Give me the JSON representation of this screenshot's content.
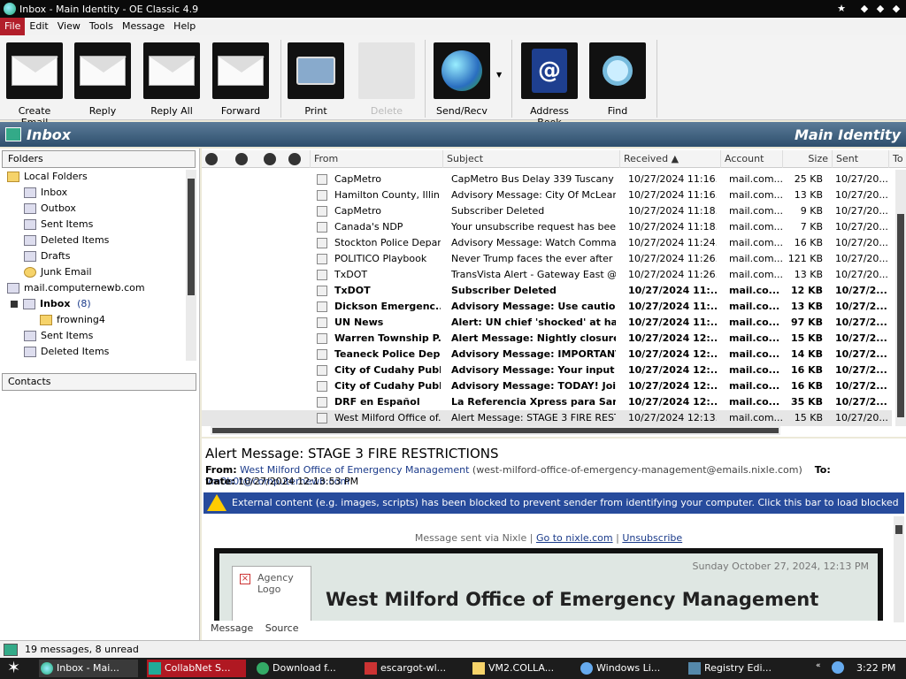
{
  "window": {
    "title": "Inbox - Main Identity - OE Classic 4.9"
  },
  "menu": [
    "File",
    "Edit",
    "View",
    "Tools",
    "Message",
    "Help"
  ],
  "toolbar": [
    {
      "label": "Create Email",
      "icon": "create-email-icon",
      "enabled": true
    },
    {
      "label": "Reply",
      "icon": "reply-icon",
      "enabled": true
    },
    {
      "label": "Reply All",
      "icon": "reply-all-icon",
      "enabled": true
    },
    {
      "label": "Forward",
      "icon": "forward-icon",
      "enabled": true
    },
    {
      "label": "Print",
      "icon": "print-icon",
      "enabled": true
    },
    {
      "label": "Delete",
      "icon": "delete-icon",
      "enabled": false
    },
    {
      "label": "Send/Recv",
      "icon": "send-receive-icon",
      "enabled": true
    },
    {
      "label": "Address Book",
      "icon": "address-book-icon",
      "enabled": true
    },
    {
      "label": "Find",
      "icon": "find-icon",
      "enabled": true
    }
  ],
  "banner": {
    "folder": "Inbox",
    "identity": "Main Identity"
  },
  "folders": {
    "header": "Folders",
    "items": [
      {
        "label": "Local Folders",
        "level": 0
      },
      {
        "label": "Inbox",
        "level": 1
      },
      {
        "label": "Outbox",
        "level": 1
      },
      {
        "label": "Sent Items",
        "level": 1
      },
      {
        "label": "Deleted Items",
        "level": 1
      },
      {
        "label": "Drafts",
        "level": 1
      },
      {
        "label": "Junk Email",
        "level": 1
      },
      {
        "label": "mail.computernewb.com",
        "level": 0
      },
      {
        "label": "Inbox",
        "level": 1,
        "count": "(8)",
        "bold": true
      },
      {
        "label": "frowning4",
        "level": 2
      },
      {
        "label": "Sent Items",
        "level": 1
      },
      {
        "label": "Deleted Items",
        "level": 1
      }
    ]
  },
  "contacts": {
    "header": "Contacts"
  },
  "columns": {
    "from": "From",
    "subject": "Subject",
    "received": "Received",
    "account": "Account",
    "size": "Size",
    "sent": "Sent",
    "to": "To"
  },
  "messages": [
    {
      "from": "CapMetro",
      "subject": "CapMetro Bus Delay 339 Tuscany",
      "received": "10/27/2024 11:16...",
      "account": "mail.com...",
      "size": "25 KB",
      "sent": "10/27/20...",
      "unread": false
    },
    {
      "from": "Hamilton County, Illin...",
      "subject": "Advisory Message: City Of McLeans...",
      "received": "10/27/2024 11:16...",
      "account": "mail.com...",
      "size": "13 KB",
      "sent": "10/27/20...",
      "unread": false
    },
    {
      "from": "CapMetro",
      "subject": "Subscriber Deleted",
      "received": "10/27/2024 11:18...",
      "account": "mail.com...",
      "size": "9 KB",
      "sent": "10/27/20...",
      "unread": false
    },
    {
      "from": "Canada's NDP",
      "subject": "Your unsubscribe request has been ...",
      "received": "10/27/2024 11:18...",
      "account": "mail.com...",
      "size": "7 KB",
      "sent": "10/27/20...",
      "unread": false
    },
    {
      "from": "Stockton Police Depar...",
      "subject": "Advisory Message: Watch Comman...",
      "received": "10/27/2024 11:24...",
      "account": "mail.com...",
      "size": "16 KB",
      "sent": "10/27/20...",
      "unread": false
    },
    {
      "from": "POLITICO Playbook",
      "subject": "Never Trump faces the ever after",
      "received": "10/27/2024 11:26...",
      "account": "mail.com...",
      "size": "121 KB",
      "sent": "10/27/20...",
      "unread": false
    },
    {
      "from": "TxDOT",
      "subject": "TransVista Alert - Gateway East @ ...",
      "received": "10/27/2024 11:26...",
      "account": "mail.com...",
      "size": "13 KB",
      "sent": "10/27/20...",
      "unread": false
    },
    {
      "from": "TxDOT",
      "subject": "Subscriber Deleted",
      "received": "10/27/2024 11:...",
      "account": "mail.co...",
      "size": "12 KB",
      "sent": "10/27/2...",
      "unread": true
    },
    {
      "from": "Dickson Emergenc...",
      "subject": "Advisory Message: Use caution...",
      "received": "10/27/2024 11:...",
      "account": "mail.co...",
      "size": "13 KB",
      "sent": "10/27/2...",
      "unread": true
    },
    {
      "from": "UN News",
      "subject": "Alert: UN chief 'shocked' at harr...",
      "received": "10/27/2024 11:...",
      "account": "mail.co...",
      "size": "97 KB",
      "sent": "10/27/2...",
      "unread": true
    },
    {
      "from": "Warren Township P...",
      "subject": "Alert Message: Nightly closures...",
      "received": "10/27/2024 12:...",
      "account": "mail.co...",
      "size": "15 KB",
      "sent": "10/27/2...",
      "unread": true
    },
    {
      "from": "Teaneck Police Dep...",
      "subject": "Advisory Message: IMPORTANT...",
      "received": "10/27/2024 12:...",
      "account": "mail.co...",
      "size": "14 KB",
      "sent": "10/27/2...",
      "unread": true
    },
    {
      "from": "City of Cudahy Publ...",
      "subject": "Advisory Message: Your input ...",
      "received": "10/27/2024 12:...",
      "account": "mail.co...",
      "size": "16 KB",
      "sent": "10/27/2...",
      "unread": true
    },
    {
      "from": "City of Cudahy Publ...",
      "subject": "Advisory Message: TODAY! Join...",
      "received": "10/27/2024 12:...",
      "account": "mail.co...",
      "size": "16 KB",
      "sent": "10/27/2...",
      "unread": true
    },
    {
      "from": "DRF en Español",
      "subject": "La Referencia Xpress para Sant...",
      "received": "10/27/2024 12:...",
      "account": "mail.co...",
      "size": "35 KB",
      "sent": "10/27/2...",
      "unread": true
    },
    {
      "from": "West Milford Office of...",
      "subject": "Alert Message: STAGE 3 FIRE REST...",
      "received": "10/27/2024 12:13...",
      "account": "mail.com...",
      "size": "15 KB",
      "sent": "10/27/20...",
      "unread": false,
      "selected": true
    }
  ],
  "preview": {
    "subject": "Alert Message: STAGE 3 FIRE RESTRICTIONS",
    "from_label": "From:",
    "from_name": "West Milford Office of Emergency Management",
    "from_email": "(west-milford-office-of-emergency-management@emails.nixle.com)",
    "to_label": "To:",
    "to": "vm0b0t@computernewb.com",
    "date_label": "Date:",
    "date": "10/27/2024 12:13:53 PM",
    "warning": "External content (e.g. images, scripts) has been blocked to prevent sender from identifying your computer. Click this bar to load blocked content.",
    "sent_via": "Message sent via Nixle |",
    "goto": "Go to nixle.com",
    "pipe": "|",
    "unsubscribe": "Unsubscribe",
    "logo_text": "Agency Logo",
    "email_date": "Sunday October 27, 2024, 12:13 PM",
    "email_title": "West Milford Office of Emergency Management",
    "tab_message": "Message",
    "tab_source": "Source"
  },
  "status": "19 messages, 8 unread",
  "taskbar": {
    "tasks": [
      "Inbox - Mai...",
      "CollabNet S...",
      "Download f...",
      "escargot-wl...",
      "VM2.COLLA...",
      "Windows Li...",
      "Registry Edi..."
    ],
    "clock": "3:22 PM"
  },
  "colors": {
    "accent": "#b21e2a",
    "banner": "#3e5f7e",
    "warning": "#274b9c"
  }
}
